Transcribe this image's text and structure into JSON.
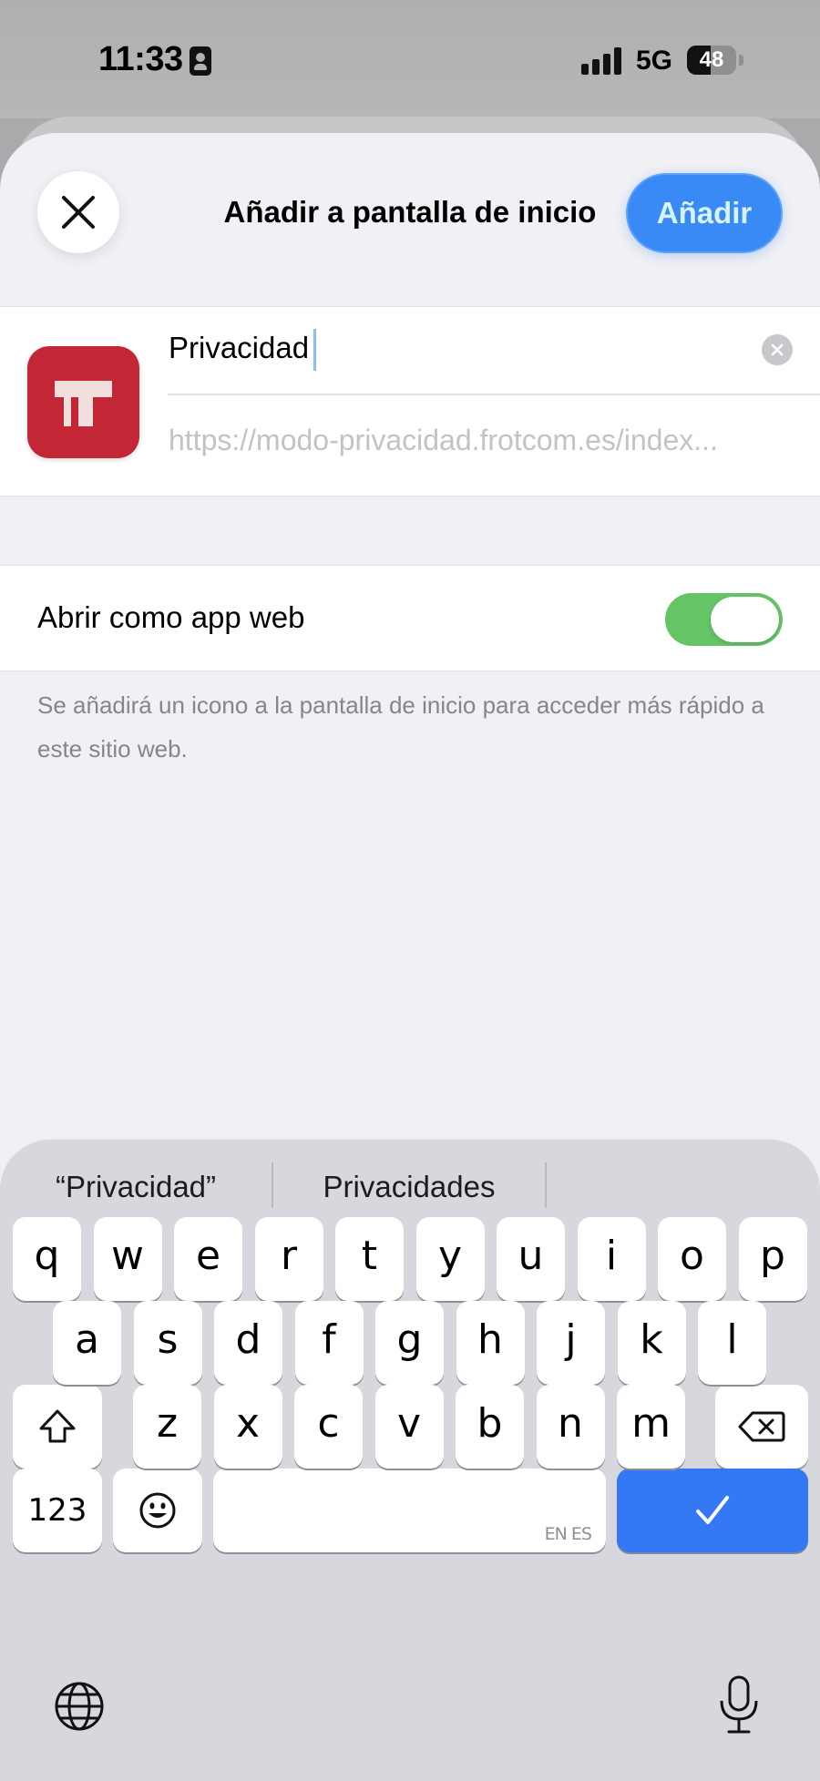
{
  "status_bar": {
    "time": "11:33",
    "network": "5G",
    "battery": "48",
    "battery_level": 0.48
  },
  "sheet": {
    "title": "Añadir a pantalla de inicio",
    "add_label": "Añadir",
    "name_value": "Privacidad",
    "url": "https://modo-privacidad.frotcom.es/index...",
    "toggle_label": "Abrir como app web",
    "toggle_on": true,
    "footnote": "Se añadirá un icono a la pantalla de inicio para acceder más rápido a este sitio web.",
    "accent_color": "#3a8af5",
    "toggle_color": "#65c466",
    "app_icon_color": "#c32635"
  },
  "keyboard": {
    "suggestions": [
      "“Privacidad”",
      "Privacidades"
    ],
    "row1": [
      "q",
      "w",
      "e",
      "r",
      "t",
      "y",
      "u",
      "i",
      "o",
      "p"
    ],
    "row2": [
      "a",
      "s",
      "d",
      "f",
      "g",
      "h",
      "j",
      "k",
      "l"
    ],
    "row3": [
      "z",
      "x",
      "c",
      "v",
      "b",
      "n",
      "m"
    ],
    "numbers_label": "123",
    "space_lang": "EN ES",
    "icons": [
      "shift-icon",
      "delete-icon",
      "emoji-icon",
      "checkmark-icon",
      "globe-icon",
      "microphone-icon"
    ]
  }
}
